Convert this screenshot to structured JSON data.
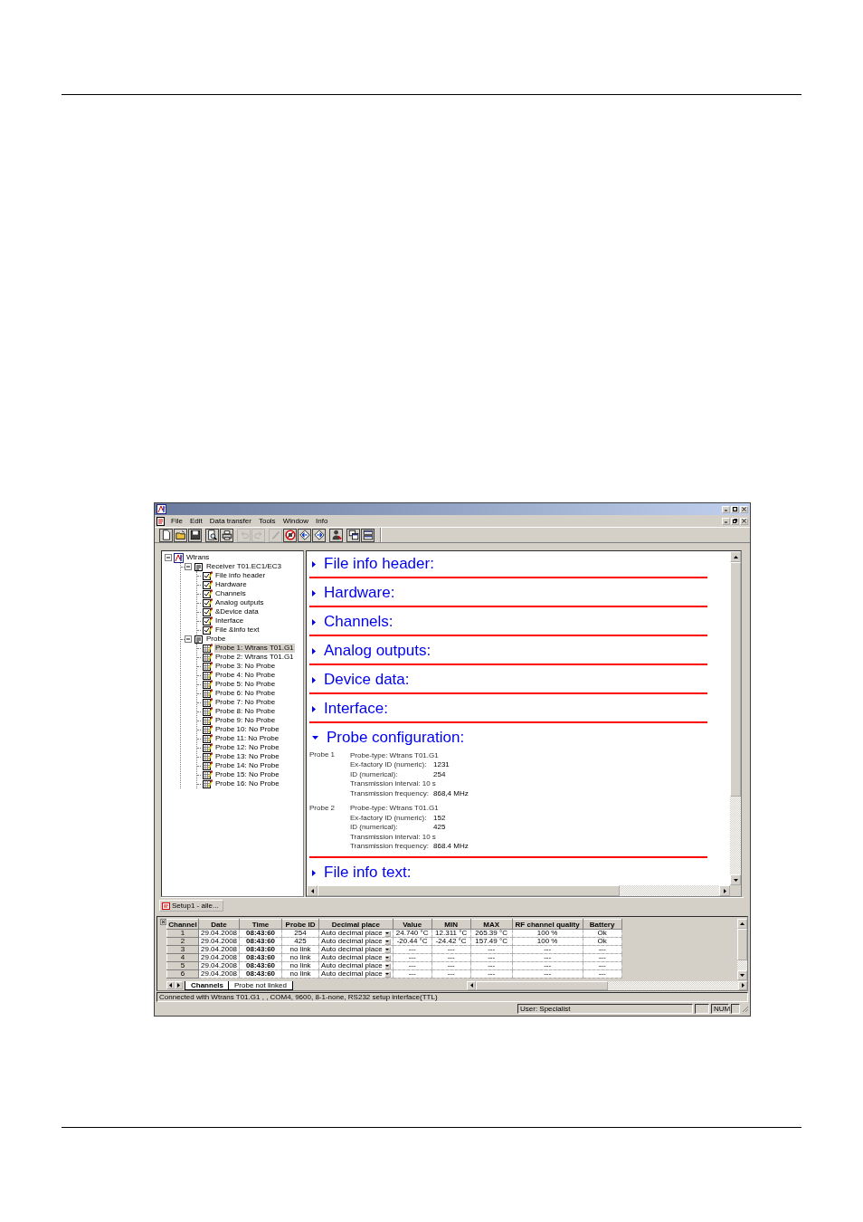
{
  "menu": [
    {
      "label": "File"
    },
    {
      "label": "Edit"
    },
    {
      "label": "Data transfer"
    },
    {
      "label": "Tools"
    },
    {
      "label": "Window"
    },
    {
      "label": "Info"
    }
  ],
  "toolbar_groups": [
    {
      "buttons": [
        {
          "kind": "new",
          "disabled": false
        },
        {
          "kind": "open",
          "disabled": false
        },
        {
          "kind": "save",
          "disabled": false
        }
      ]
    },
    {
      "buttons": [
        {
          "kind": "preview",
          "disabled": false
        },
        {
          "kind": "print",
          "disabled": false
        }
      ]
    },
    {
      "buttons": [
        {
          "kind": "undo",
          "disabled": true
        },
        {
          "kind": "redo",
          "disabled": true
        }
      ]
    },
    {
      "buttons": [
        {
          "kind": "wand",
          "disabled": true
        },
        {
          "kind": "stop",
          "disabled": false
        },
        {
          "kind": "back",
          "disabled": false
        },
        {
          "kind": "forward",
          "disabled": false
        }
      ]
    },
    {
      "buttons": [
        {
          "kind": "user",
          "disabled": false
        }
      ]
    },
    {
      "buttons": [
        {
          "kind": "cascade",
          "disabled": false
        },
        {
          "kind": "tile",
          "disabled": false
        }
      ]
    }
  ],
  "tree": [
    {
      "label": "Wtrans",
      "kind": "root",
      "selected": false,
      "expanded": true,
      "children": [
        {
          "label": "Receiver T01.EC1/EC3",
          "kind": "folder",
          "selected": false,
          "expanded": true,
          "children": [
            {
              "label": "File info header",
              "kind": "sheet",
              "selected": false
            },
            {
              "label": "Hardware",
              "kind": "sheet",
              "selected": false
            },
            {
              "label": "Channels",
              "kind": "sheet",
              "selected": false
            },
            {
              "label": "Analog outputs",
              "kind": "sheet",
              "selected": false
            },
            {
              "label": "&Device data",
              "kind": "sheet",
              "selected": false
            },
            {
              "label": "Interface",
              "kind": "sheet",
              "selected": false
            },
            {
              "label": "File &info text",
              "kind": "sheet",
              "selected": false
            }
          ]
        },
        {
          "label": "Probe",
          "kind": "folder",
          "selected": false,
          "expanded": true,
          "children": [
            {
              "label": "Probe 1: Wtrans T01.G1",
              "kind": "probe",
              "selected": true
            },
            {
              "label": "Probe 2: Wtrans T01.G1",
              "kind": "probe",
              "selected": false
            },
            {
              "label": "Probe 3:  No Probe",
              "kind": "probe",
              "selected": false
            },
            {
              "label": "Probe 4:  No Probe",
              "kind": "probe",
              "selected": false
            },
            {
              "label": "Probe 5:  No Probe",
              "kind": "probe",
              "selected": false
            },
            {
              "label": "Probe 6:  No Probe",
              "kind": "probe",
              "selected": false
            },
            {
              "label": "Probe 7:  No Probe",
              "kind": "probe",
              "selected": false
            },
            {
              "label": "Probe 8:  No Probe",
              "kind": "probe",
              "selected": false
            },
            {
              "label": "Probe 9:  No Probe",
              "kind": "probe",
              "selected": false
            },
            {
              "label": "Probe 10:  No Probe",
              "kind": "probe",
              "selected": false
            },
            {
              "label": "Probe 11:  No Probe",
              "kind": "probe",
              "selected": false
            },
            {
              "label": "Probe 12:  No Probe",
              "kind": "probe",
              "selected": false
            },
            {
              "label": "Probe 13:  No Probe",
              "kind": "probe",
              "selected": false
            },
            {
              "label": "Probe 14:  No Probe",
              "kind": "probe",
              "selected": false
            },
            {
              "label": "Probe 15:  No Probe",
              "kind": "probe",
              "selected": false
            },
            {
              "label": "Probe 16:  No Probe",
              "kind": "probe",
              "selected": false
            }
          ]
        }
      ]
    }
  ],
  "sections": [
    {
      "title": "File info header:",
      "expanded": false
    },
    {
      "title": "Hardware:",
      "expanded": false
    },
    {
      "title": "Channels:",
      "expanded": false
    },
    {
      "title": "Analog outputs:",
      "expanded": false
    },
    {
      "title": "Device data:",
      "expanded": false
    },
    {
      "title": "Interface:",
      "expanded": false
    },
    {
      "title": "Probe configuration:",
      "expanded": true,
      "probes": [
        {
          "label": "Probe 1",
          "lines": [
            {
              "label": "Probe-type: Wtrans T01.G1"
            },
            {
              "label": "Ex-factory ID (numeric):",
              "value": "1231"
            },
            {
              "label": "ID (numerical):",
              "value": "254"
            },
            {
              "label": "Transmission interval: 10 s"
            },
            {
              "label": "Transmission frequency:",
              "value": "868,4 MHz"
            }
          ]
        },
        {
          "label": "Probe 2",
          "lines": [
            {
              "label": "Probe-type: Wtrans T01.G1"
            },
            {
              "label": "Ex-factory ID (numeric):",
              "value": "152"
            },
            {
              "label": "ID (numerical):",
              "value": "425"
            },
            {
              "label": "Transmission interval: 10 s"
            },
            {
              "label": "Transmission frequency:",
              "value": "868.4 MHz"
            }
          ]
        }
      ]
    },
    {
      "title": "File info text:",
      "expanded": false
    }
  ],
  "document_tab": {
    "label": "Setup1 - alle..."
  },
  "table": {
    "columns": [
      "Channel",
      "Date",
      "Time",
      "Probe ID",
      "Decimal place",
      "Value",
      "MIN",
      "MAX",
      "RF channel quality",
      "Battery"
    ],
    "rows": [
      [
        "1",
        "29.04.2008",
        "08:43:60",
        "254",
        "Auto decimal place",
        "24.740 °C",
        "12.311 °C",
        "265.39 °C",
        "100 %",
        "Ok"
      ],
      [
        "2",
        "29.04.2008",
        "08:43:60",
        "425",
        "Auto decimal place",
        "-20.44 °C",
        "-24.42 °C",
        "157.49 °C",
        "100 %",
        "Ok"
      ],
      [
        "3",
        "29.04.2008",
        "08:43:60",
        "no link",
        "Auto decimal place",
        "---",
        "---",
        "---",
        "---",
        "---"
      ],
      [
        "4",
        "29.04.2008",
        "08:43:60",
        "no link",
        "Auto decimal place",
        "---",
        "---",
        "---",
        "---",
        "---"
      ],
      [
        "5",
        "29.04.2008",
        "08:43:60",
        "no link",
        "Auto decimal place",
        "---",
        "---",
        "---",
        "---",
        "---"
      ],
      [
        "6",
        "29.04.2008",
        "08:43:60",
        "no link",
        "Auto decimal place",
        "---",
        "---",
        "---",
        "---",
        "---"
      ]
    ]
  },
  "sheet_tabs": [
    {
      "label": "Channels",
      "selected": true
    },
    {
      "label": "Probe not linked",
      "selected": false
    }
  ],
  "status_bar": {
    "connection": "Connected with Wtrans T01.G1 , , COM4, 9600, 8-1-none, RS232 setup interface(TTL)",
    "user": "User: Specialist",
    "num": "NUM"
  }
}
